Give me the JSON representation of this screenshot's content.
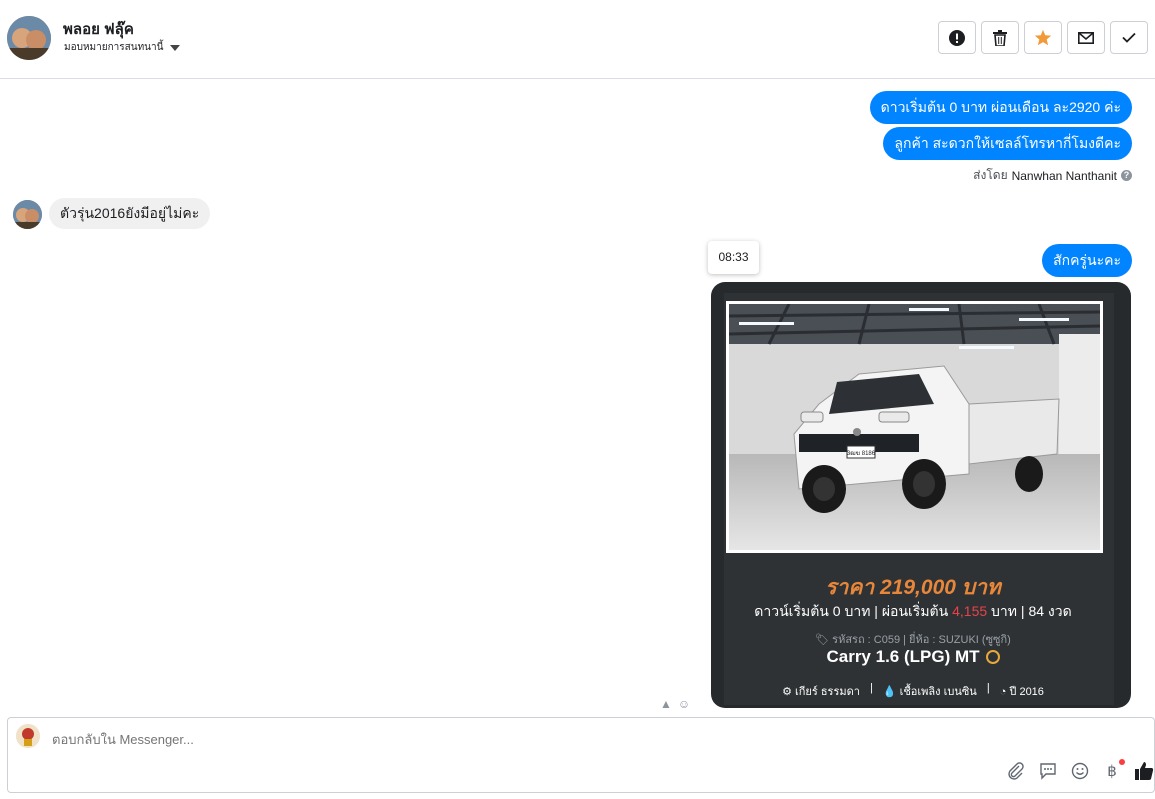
{
  "header": {
    "name": "พลอย ฟลุ๊ค",
    "assign_label": "มอบหมายการสนทนานี้",
    "tools": [
      "mark-spam-icon",
      "delete-icon",
      "star-icon",
      "mark-unread-icon",
      "done-icon"
    ]
  },
  "messages": {
    "out_1": "ดาวเริ่มต้น 0 บาท ผ่อนเดือน ละ2920 ค่ะ",
    "out_2": "ลูกค้า สะดวกให้เซลล์โทรหากี่โมงดีคะ",
    "sent_by_label": "ส่งโดย",
    "sent_by_name": "Nanwhan Nanthanit",
    "in_1": "ตัวรุ่น2016ยังมีอยู่ไม่คะ",
    "time_tooltip": "08:33",
    "out_3": "สักครู่นะคะ"
  },
  "card": {
    "price": "ราคา 219,000 บาท",
    "installment_prefix": "ดาวน์เริ่มต้น 0 บาท | ผ่อนเริ่มต้น",
    "installment_amount": "4,155",
    "installment_suffix": "บาท | 84 งวด",
    "meta": "รหัสรถ : C059 | ยี่ห้อ : SUZUKI (ซูซูกิ)",
    "model": "Carry 1.6 (LPG) MT",
    "spec_gear": "เกียร์ ธรรมดา",
    "spec_fuel": "เชื้อเพลิง เบนซิน",
    "spec_year": "ปี 2016",
    "plate": "3ฒฆ 8186"
  },
  "composer": {
    "placeholder": "ตอบกลับใน Messenger..."
  },
  "colors": {
    "accent": "#0084ff",
    "price": "#e8863a",
    "installment_amount": "#e8434a"
  }
}
